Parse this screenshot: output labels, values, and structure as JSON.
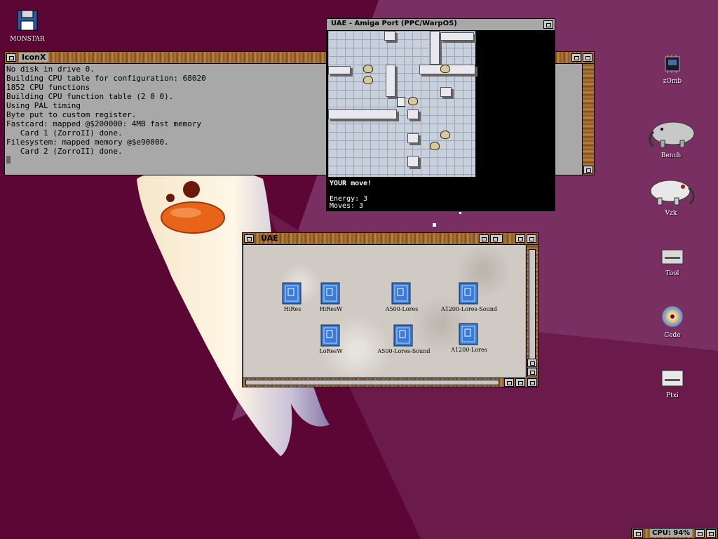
{
  "desktop": {
    "icons": [
      {
        "label": "MONSTAR",
        "icon": "floppy-disk-icon"
      },
      {
        "label": "zOmb",
        "icon": "chip-icon"
      },
      {
        "label": "Bench",
        "icon": "elephant-icon"
      },
      {
        "label": "Vzk",
        "icon": "elephant-icon"
      },
      {
        "label": "Tool",
        "icon": "drive-icon"
      },
      {
        "label": "Cede",
        "icon": "cd-icon"
      },
      {
        "label": "Ptxi",
        "icon": "drive-icon"
      }
    ]
  },
  "iconx": {
    "title": "IconX",
    "lines": [
      "No disk in drive 0.",
      "Building CPU table for configuration: 68020",
      "1852 CPU functions",
      "Building CPU function table (2 0 0).",
      "Using PAL timing",
      "Byte put to custom register.",
      "Fastcard: mapped @$200000: 4MB fast memory",
      "   Card 1 (ZorroII) done.",
      "Filesystem: mapped memory @$e90000.",
      "   Card 2 (ZorroII) done."
    ]
  },
  "game_window": {
    "title": "UAE - Amiga Port (PPC/WarpOS)",
    "status": "YOUR move!",
    "energy": "Energy: 3",
    "moves": "Moves: 3"
  },
  "uae_drawer": {
    "title": "UAE",
    "files": [
      {
        "label": "HiRes"
      },
      {
        "label": "HiResW"
      },
      {
        "label": "A500-Lores"
      },
      {
        "label": "A1200-Lores-Sound"
      },
      {
        "label": "LoResW"
      },
      {
        "label": "A500-Lores-Sound"
      },
      {
        "label": "A1200-Lores"
      }
    ]
  },
  "cpu_meter": {
    "label": "CPU: 94%"
  },
  "colors": {
    "desktop": "#5c0636",
    "titlebar": "#b0793a",
    "window_bg": "#a8a8a8"
  }
}
